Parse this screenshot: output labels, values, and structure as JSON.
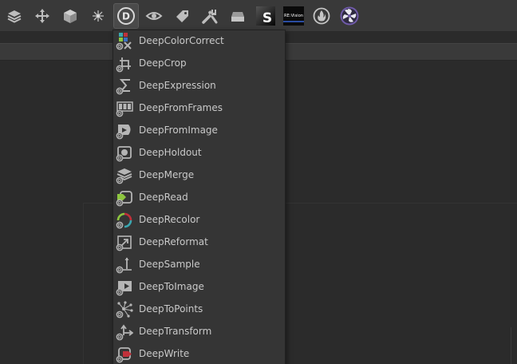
{
  "toolbar": {
    "buttons": [
      {
        "icon": "layers-icon"
      },
      {
        "icon": "move-icon"
      },
      {
        "icon": "cube-icon"
      },
      {
        "icon": "particles-icon"
      },
      {
        "icon": "deep-icon",
        "label": "D",
        "active": true
      },
      {
        "icon": "eye-icon"
      },
      {
        "icon": "tag-icon"
      },
      {
        "icon": "wrench-icon"
      },
      {
        "icon": "drive-icon"
      },
      {
        "icon": "sapphire-icon",
        "label": "S"
      },
      {
        "icon": "revision-icon",
        "label": "RE:Vision"
      },
      {
        "icon": "flame-icon"
      },
      {
        "icon": "fan-icon"
      }
    ]
  },
  "menu": {
    "items": [
      {
        "label": "DeepColorCorrect",
        "icon": "deep-color-correct-icon"
      },
      {
        "label": "DeepCrop",
        "icon": "deep-crop-icon"
      },
      {
        "label": "DeepExpression",
        "icon": "deep-expression-icon"
      },
      {
        "label": "DeepFromFrames",
        "icon": "deep-from-frames-icon"
      },
      {
        "label": "DeepFromImage",
        "icon": "deep-from-image-icon"
      },
      {
        "label": "DeepHoldout",
        "icon": "deep-holdout-icon"
      },
      {
        "label": "DeepMerge",
        "icon": "deep-merge-icon"
      },
      {
        "label": "DeepRead",
        "icon": "deep-read-icon"
      },
      {
        "label": "DeepRecolor",
        "icon": "deep-recolor-icon"
      },
      {
        "label": "DeepReformat",
        "icon": "deep-reformat-icon"
      },
      {
        "label": "DeepSample",
        "icon": "deep-sample-icon"
      },
      {
        "label": "DeepToImage",
        "icon": "deep-to-image-icon"
      },
      {
        "label": "DeepToPoints",
        "icon": "deep-to-points-icon"
      },
      {
        "label": "DeepTransform",
        "icon": "deep-transform-icon"
      },
      {
        "label": "DeepWrite",
        "icon": "deep-write-icon"
      }
    ]
  },
  "colors": {
    "menu_text": "#c9c9c9",
    "icon_gray": "#b5b5b5",
    "accent_green": "#8dc63f",
    "accent_red": "#c0303a",
    "accent_teal": "#3aa7b0",
    "sapphire_bg": "#111111",
    "fan_purple": "#6f5aa8"
  }
}
